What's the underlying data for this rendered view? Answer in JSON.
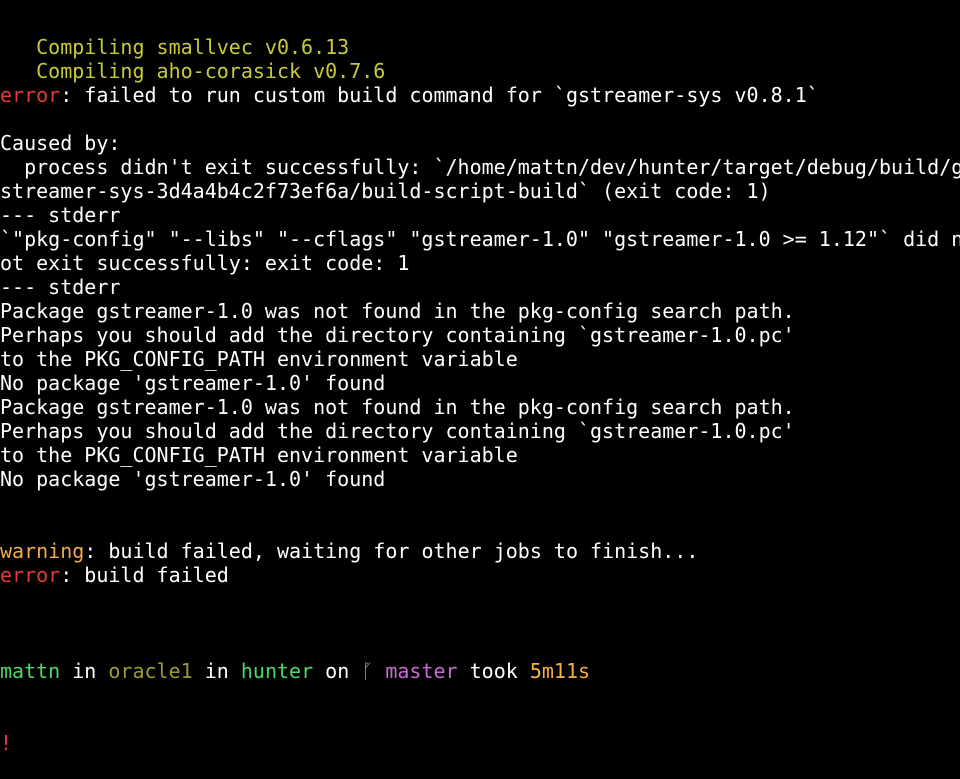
{
  "colors": {
    "background": "#000000",
    "text": "#ffffff",
    "compiling": "#c9c93a",
    "error": "#e23b3b",
    "warning": "#f0a94b",
    "user": "#4fd66a",
    "host": "#9a9a37",
    "dir": "#4fd66a",
    "branch": "#c86bd3",
    "duration": "#f5b041"
  },
  "terminal": {
    "lines": [
      {
        "segments": [
          {
            "text": "   Compiling smallvec v0.6.13",
            "color": "compiling"
          }
        ]
      },
      {
        "segments": [
          {
            "text": "   Compiling aho-corasick v0.7.6",
            "color": "compiling"
          }
        ]
      },
      {
        "segments": [
          {
            "text": "error",
            "color": "error"
          },
          {
            "text": ": failed to run custom build command for `gstreamer-sys v0.8.1`",
            "color": "text"
          }
        ]
      },
      {
        "segments": [
          {
            "text": "",
            "color": "text"
          }
        ]
      },
      {
        "segments": [
          {
            "text": "Caused by:",
            "color": "text"
          }
        ]
      },
      {
        "segments": [
          {
            "text": "  process didn't exit successfully: `/home/mattn/dev/hunter/target/debug/build/g",
            "color": "text"
          }
        ]
      },
      {
        "segments": [
          {
            "text": "streamer-sys-3d4a4b4c2f73ef6a/build-script-build` (exit code: 1)",
            "color": "text"
          }
        ]
      },
      {
        "segments": [
          {
            "text": "--- stderr",
            "color": "text"
          }
        ]
      },
      {
        "segments": [
          {
            "text": "`\"pkg-config\" \"--libs\" \"--cflags\" \"gstreamer-1.0\" \"gstreamer-1.0 >= 1.12\"` did n",
            "color": "text"
          }
        ]
      },
      {
        "segments": [
          {
            "text": "ot exit successfully: exit code: 1",
            "color": "text"
          }
        ]
      },
      {
        "segments": [
          {
            "text": "--- stderr",
            "color": "text"
          }
        ]
      },
      {
        "segments": [
          {
            "text": "Package gstreamer-1.0 was not found in the pkg-config search path.",
            "color": "text"
          }
        ]
      },
      {
        "segments": [
          {
            "text": "Perhaps you should add the directory containing `gstreamer-1.0.pc'",
            "color": "text"
          }
        ]
      },
      {
        "segments": [
          {
            "text": "to the PKG_CONFIG_PATH environment variable",
            "color": "text"
          }
        ]
      },
      {
        "segments": [
          {
            "text": "No package 'gstreamer-1.0' found",
            "color": "text"
          }
        ]
      },
      {
        "segments": [
          {
            "text": "Package gstreamer-1.0 was not found in the pkg-config search path.",
            "color": "text"
          }
        ]
      },
      {
        "segments": [
          {
            "text": "Perhaps you should add the directory containing `gstreamer-1.0.pc'",
            "color": "text"
          }
        ]
      },
      {
        "segments": [
          {
            "text": "to the PKG_CONFIG_PATH environment variable",
            "color": "text"
          }
        ]
      },
      {
        "segments": [
          {
            "text": "No package 'gstreamer-1.0' found",
            "color": "text"
          }
        ]
      },
      {
        "segments": [
          {
            "text": "",
            "color": "text"
          }
        ]
      },
      {
        "segments": [
          {
            "text": "",
            "color": "text"
          }
        ]
      },
      {
        "segments": [
          {
            "text": "warning",
            "color": "warning"
          },
          {
            "text": ": build failed, waiting for other jobs to finish...",
            "color": "text"
          }
        ]
      },
      {
        "segments": [
          {
            "text": "error",
            "color": "error"
          },
          {
            "text": ": build failed",
            "color": "text"
          }
        ]
      },
      {
        "segments": [
          {
            "text": "",
            "color": "text"
          }
        ]
      }
    ],
    "prompt": {
      "user": "mattn",
      "in1": " in ",
      "host": "oracle1",
      "in2": " in ",
      "dir": "hunter",
      "on": " on ",
      "branch_icon": "ᚵ",
      "branch": " master",
      "took": " took ",
      "duration": "5m11s",
      "symbol": "!"
    }
  }
}
